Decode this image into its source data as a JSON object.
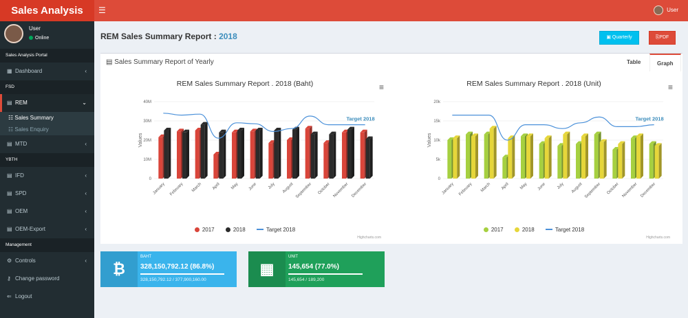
{
  "app": {
    "logo": "Sales Analysis",
    "menu_icon": "hamburger-icon",
    "user": "User"
  },
  "sidebar": {
    "user": {
      "name": "User",
      "status": "Online"
    },
    "sections": [
      {
        "header": "Sales Analysis Portal",
        "items": [
          {
            "label": "Dashboard",
            "icon": "dashboard-icon",
            "chevron": "‹"
          }
        ]
      },
      {
        "header": "FSD",
        "items": [
          {
            "label": "REM",
            "icon": "file-icon",
            "chevron": "⌄",
            "active": true
          }
        ]
      },
      {
        "sub": [
          {
            "label": "Sales Summary"
          },
          {
            "label": "Sales Enquiry"
          }
        ]
      },
      {
        "items": [
          {
            "label": "MTD",
            "icon": "file-icon",
            "chevron": "‹"
          }
        ]
      },
      {
        "header": "YBTH",
        "items": [
          {
            "label": "IFD",
            "chevron": "‹"
          },
          {
            "label": "SPD",
            "chevron": "‹"
          },
          {
            "label": "OEM",
            "chevron": "‹"
          },
          {
            "label": "OEM-Export",
            "chevron": "‹"
          }
        ]
      },
      {
        "header": "Management",
        "items": [
          {
            "label": "Controls",
            "chevron": "‹"
          },
          {
            "label": "Change password"
          },
          {
            "label": "Logout"
          }
        ]
      }
    ]
  },
  "page": {
    "title": "REM Sales Summary Report : ",
    "year": "2018"
  },
  "buttons": {
    "quarterly": "Quarterly",
    "pdf": "PDF"
  },
  "box": {
    "title": "Sales Summary Report of Yearly",
    "tab_table": "Table",
    "tab_graph": "Graph"
  },
  "chart_data": [
    {
      "type": "bar",
      "title": "REM Sales Summary Report . 2018 (Baht)",
      "ylabel": "Values",
      "yticks": [
        "0",
        "10M",
        "20M",
        "30M",
        "40M"
      ],
      "ylim": [
        0,
        40000000
      ],
      "categories": [
        "January",
        "February",
        "March",
        "April",
        "May",
        "June",
        "July",
        "August",
        "September",
        "October",
        "November",
        "December"
      ],
      "series": [
        {
          "name": "2017",
          "color": "#d9453a",
          "values": [
            21500000,
            24500000,
            25000000,
            12500000,
            24000000,
            24500000,
            18500000,
            20000000,
            26000000,
            18500000,
            24000000,
            24000000
          ]
        },
        {
          "name": "2018",
          "color": "#2b2b2b",
          "values": [
            25000000,
            24000000,
            28000000,
            24000000,
            25000000,
            25000000,
            25000000,
            25500000,
            23000000,
            23000000,
            25500000,
            20500000
          ]
        },
        {
          "name": "Target 2018",
          "color": "#4a90d9",
          "line": [
            34000000,
            33000000,
            33500000,
            21000000,
            29000000,
            28500000,
            24500000,
            26000000,
            32500000,
            28000000,
            28000000,
            28000000
          ]
        }
      ],
      "annotation": "Target 2018",
      "credit": "Highcharts.com"
    },
    {
      "type": "bar",
      "title": "REM Sales Summary Report . 2018 (Unit)",
      "ylabel": "Values",
      "yticks": [
        "0",
        "5k",
        "10k",
        "15k",
        "20k"
      ],
      "ylim": [
        0,
        20000
      ],
      "categories": [
        "January",
        "February",
        "March",
        "April",
        "May",
        "June",
        "July",
        "August",
        "September",
        "October",
        "November",
        "December"
      ],
      "series": [
        {
          "name": "2017",
          "color": "#a6d040",
          "values": [
            10000,
            11500,
            11500,
            5500,
            11000,
            9000,
            8500,
            9000,
            11500,
            7500,
            10500,
            9000
          ]
        },
        {
          "name": "2018",
          "color": "#e6d63a",
          "values": [
            10500,
            11000,
            13000,
            10500,
            11000,
            10500,
            11500,
            11000,
            9500,
            9000,
            11000,
            8500
          ]
        },
        {
          "name": "Target 2018",
          "color": "#4a90d9",
          "line": [
            16500,
            16500,
            16500,
            10000,
            14000,
            14000,
            13000,
            14500,
            16000,
            13500,
            13500,
            14000
          ]
        }
      ],
      "annotation": "Target 2018",
      "credit": "Highcharts.com"
    }
  ],
  "info_baht": {
    "label": "BAHT",
    "value": "328,150,792.12 (86.8%)",
    "progress": 0.868,
    "detail": "328,150,792.12 / 377,900,160.00",
    "icon": "bitcoin-icon"
  },
  "info_unit": {
    "label": "UNIT",
    "value": "145,654 (77.0%)",
    "progress": 0.77,
    "detail": "145,654 / 189,200",
    "icon": "cubes-icon"
  }
}
